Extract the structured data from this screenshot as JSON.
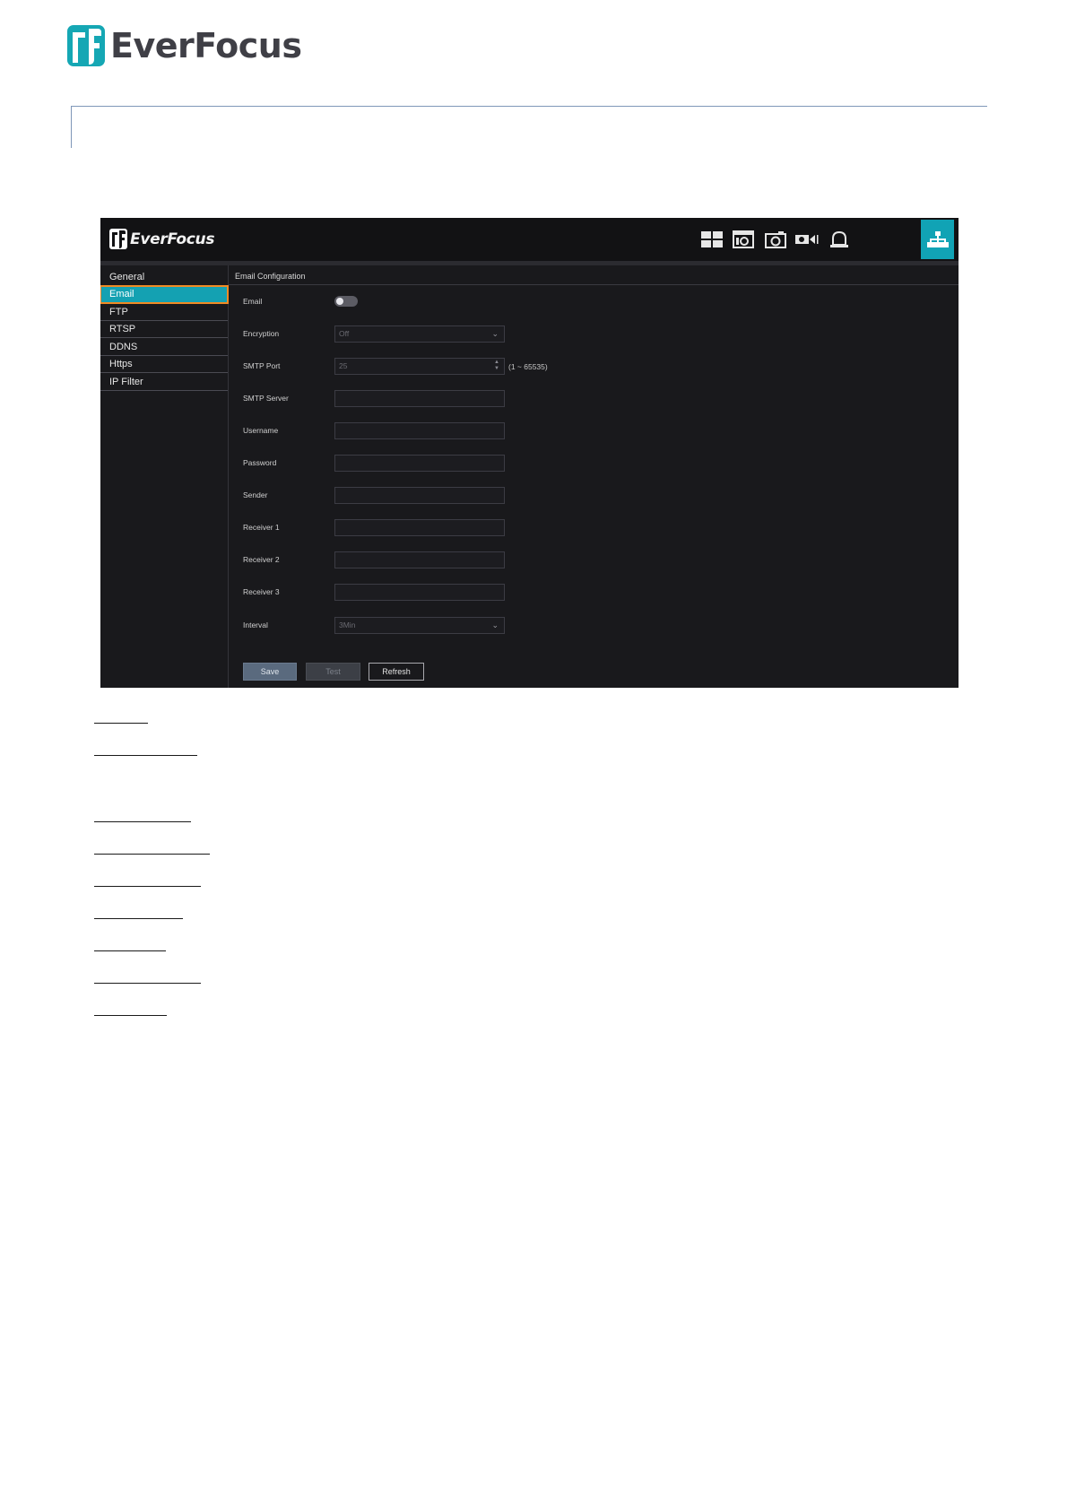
{
  "document": {
    "brand": "EverFocus"
  },
  "screenshot": {
    "app_brand": "EverFocus",
    "top_icons": [
      "preview-icon",
      "playback-icon",
      "snapshot-icon",
      "record-icon",
      "alarm-icon",
      "network-icon"
    ],
    "active_icon": "network-icon",
    "accent_color": "#14a1b2",
    "highlight_color": "#f08a24",
    "sidebar": {
      "items": [
        {
          "label": "General"
        },
        {
          "label": "Email"
        },
        {
          "label": "FTP"
        },
        {
          "label": "RTSP"
        },
        {
          "label": "DDNS"
        },
        {
          "label": "Https"
        },
        {
          "label": "IP Filter"
        }
      ],
      "selected": "Email"
    },
    "panel": {
      "title": "Email Configuration",
      "email_label": "Email",
      "email_enabled": false,
      "encryption": {
        "label": "Encryption",
        "value": "Off"
      },
      "smtp_port": {
        "label": "SMTP Port",
        "value": "25",
        "range": "(1 ~ 65535)"
      },
      "smtp_server": {
        "label": "SMTP Server",
        "value": ""
      },
      "username": {
        "label": "Username",
        "value": ""
      },
      "password": {
        "label": "Password",
        "value": ""
      },
      "sender": {
        "label": "Sender",
        "value": ""
      },
      "receiver1": {
        "label": "Receiver 1",
        "value": ""
      },
      "receiver2": {
        "label": "Receiver 2",
        "value": ""
      },
      "receiver3": {
        "label": "Receiver 3",
        "value": ""
      },
      "interval": {
        "label": "Interval",
        "value": "3Min"
      },
      "buttons": {
        "save": "Save",
        "test": "Test",
        "refresh": "Refresh"
      }
    }
  }
}
